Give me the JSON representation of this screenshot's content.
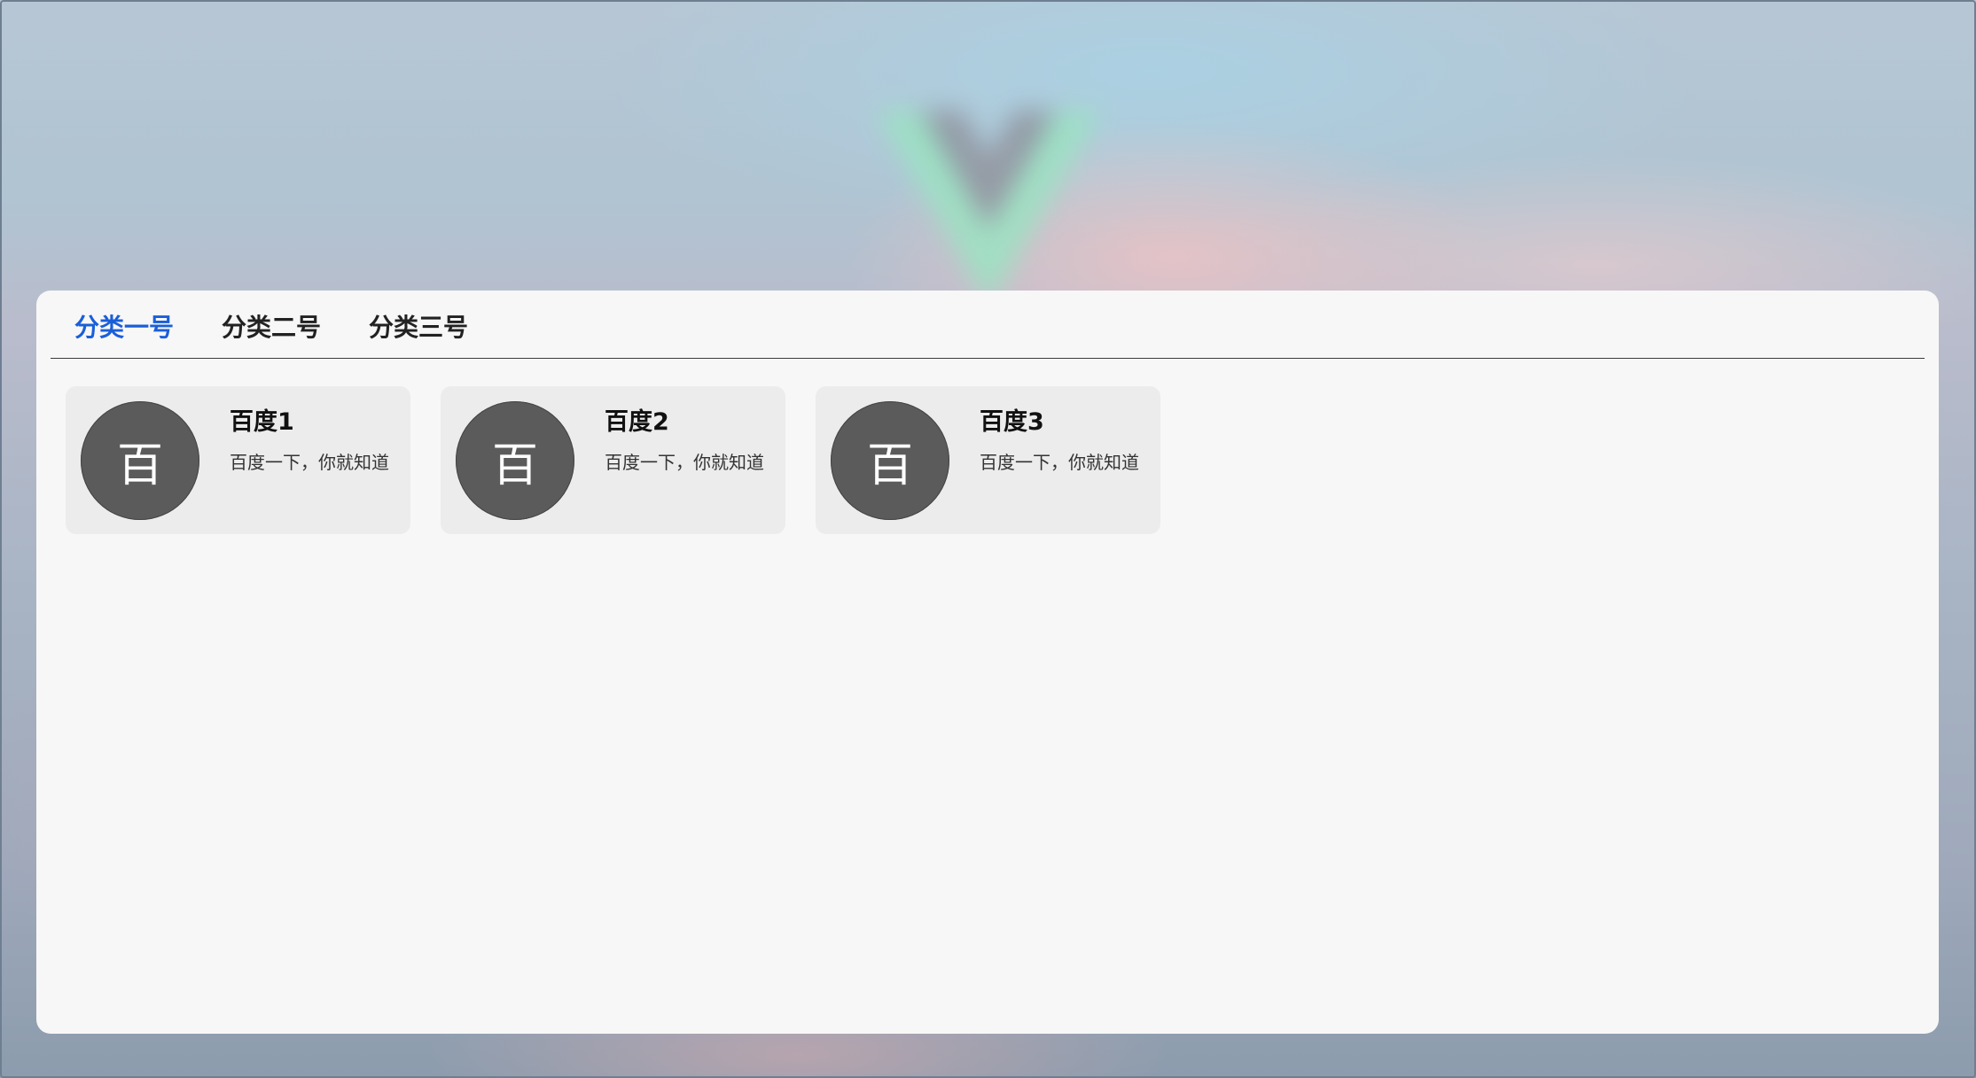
{
  "background": {
    "logo_icon": "vue-logo-icon",
    "logo_colors": {
      "outer": "#9be3c2",
      "inner": "#8f949e"
    }
  },
  "tabs": [
    {
      "label": "分类一号",
      "active": true
    },
    {
      "label": "分类二号",
      "active": false
    },
    {
      "label": "分类三号",
      "active": false
    }
  ],
  "accent_color": "#1a5fd8",
  "cards": [
    {
      "avatar_text": "百",
      "title": "百度1",
      "description": "百度一下，你就知道"
    },
    {
      "avatar_text": "百",
      "title": "百度2",
      "description": "百度一下，你就知道"
    },
    {
      "avatar_text": "百",
      "title": "百度3",
      "description": "百度一下，你就知道"
    }
  ]
}
